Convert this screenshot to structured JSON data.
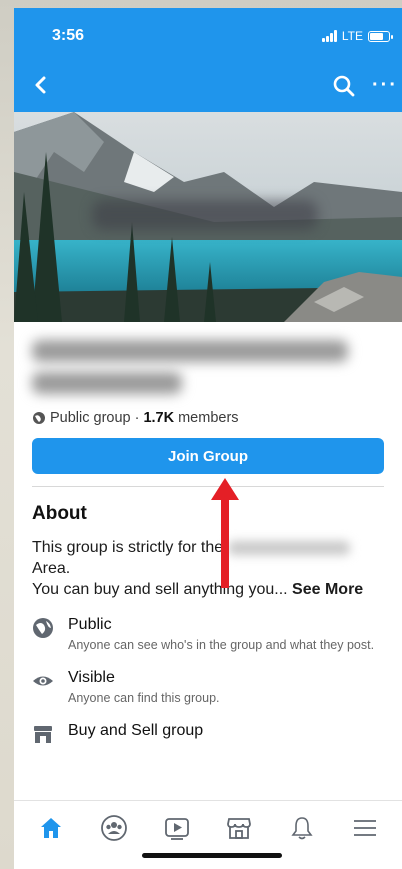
{
  "status_bar": {
    "time": "3:56",
    "network": "LTE"
  },
  "header": {
    "back_icon": "back-chevron-icon",
    "search_icon": "search-icon",
    "more_icon": "more-icon",
    "more_label": "···",
    "accent_color": "#1f95ec"
  },
  "group": {
    "privacy": "Public group",
    "separator": " · ",
    "member_count": "1.7K",
    "members_label": " members",
    "join_label": "Join Group"
  },
  "about": {
    "heading": "About",
    "text_before": "This group is strictly for the",
    "text_after": "Area.",
    "text_line2": "You can buy and sell anything you...",
    "see_more": "See More",
    "features": [
      {
        "icon": "globe-icon",
        "title": "Public",
        "subtitle": "Anyone can see who's in the group and what they post."
      },
      {
        "icon": "eye-icon",
        "title": "Visible",
        "subtitle": "Anyone can find this group."
      },
      {
        "icon": "store-icon",
        "title": "Buy and Sell group",
        "subtitle": ""
      }
    ]
  },
  "tab_bar": {
    "tabs": [
      {
        "icon": "home-icon",
        "active": true
      },
      {
        "icon": "groups-icon",
        "active": false
      },
      {
        "icon": "watch-icon",
        "active": false
      },
      {
        "icon": "marketplace-icon",
        "active": false
      },
      {
        "icon": "notifications-icon",
        "active": false
      },
      {
        "icon": "menu-icon",
        "active": false
      }
    ]
  }
}
